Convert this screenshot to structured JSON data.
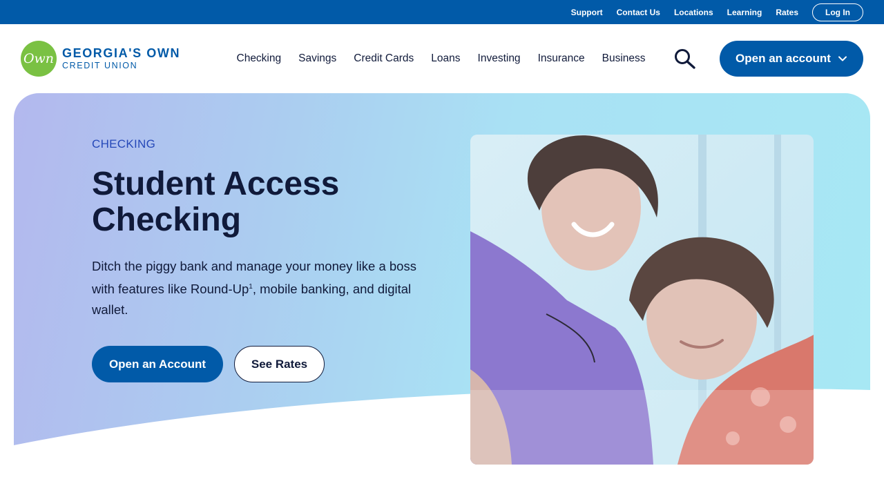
{
  "utility": {
    "links": [
      "Support",
      "Contact Us",
      "Locations",
      "Learning",
      "Rates"
    ],
    "login_label": "Log In"
  },
  "brand": {
    "logo_mark": "Own",
    "name_line1": "GEORGIA'S OWN",
    "name_line2": "CREDIT UNION"
  },
  "nav": {
    "items": [
      "Checking",
      "Savings",
      "Credit Cards",
      "Loans",
      "Investing",
      "Insurance",
      "Business"
    ],
    "search_icon": "search-icon",
    "open_account_label": "Open an account",
    "open_account_icon": "chevron-down-icon"
  },
  "hero": {
    "eyebrow": "CHECKING",
    "title": "Student Access Checking",
    "description_part1": "Ditch the piggy bank and manage your money like a boss with features like Round-Up",
    "description_sup": "1",
    "description_part2": ", mobile banking, and digital wallet.",
    "primary_cta": "Open an Account",
    "secondary_cta": "See Rates",
    "photo": "two smiling young men leaning together, photographed from below"
  },
  "colors": {
    "brand_blue": "#015aa8",
    "brand_green": "#7ac143",
    "text_dark": "#101a3a",
    "eyebrow_blue": "#2548b8",
    "hero_gradient_start": "#b3b8ee",
    "hero_gradient_end": "#a7e8f4"
  }
}
